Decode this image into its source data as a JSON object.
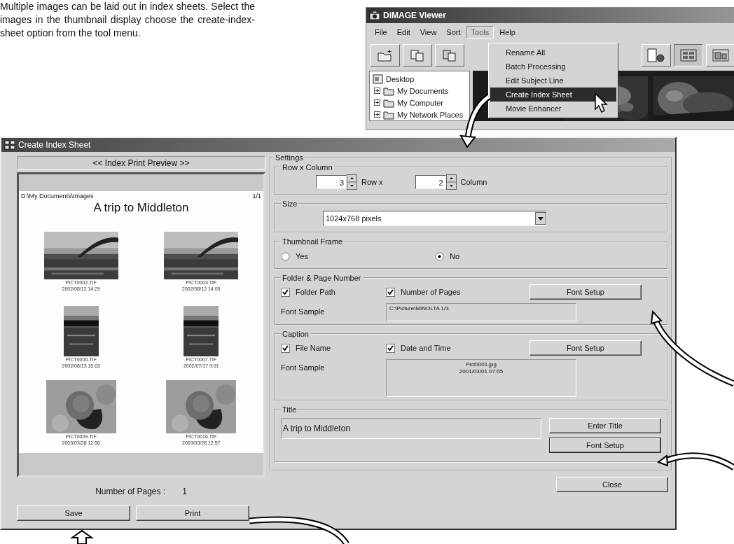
{
  "intro_text": "Multiple images can be laid out in index sheets. Select the images in the thumbnail display choose the create-index-sheet option from the tool menu.",
  "viewer": {
    "title": "DiMAGE Viewer",
    "menu": [
      {
        "label": "File",
        "selected": false
      },
      {
        "label": "Edit",
        "selected": false
      },
      {
        "label": "View",
        "selected": false
      },
      {
        "label": "Sort",
        "selected": false
      },
      {
        "label": "Tools",
        "selected": true
      },
      {
        "label": "Help",
        "selected": false
      }
    ],
    "tools_menu": [
      {
        "label": "Rename All",
        "selected": false
      },
      {
        "label": "Batch Processing",
        "selected": false
      },
      {
        "label": "Edit Subject Line",
        "selected": false
      },
      {
        "label": "Create Index Sheet",
        "selected": true
      },
      {
        "label": "Movie Enhancer",
        "selected": false
      }
    ],
    "folder_tree": [
      {
        "label": "Desktop",
        "children": [
          {
            "label": "My Documents"
          },
          {
            "label": "My Computer"
          },
          {
            "label": "My Network Places"
          }
        ]
      }
    ]
  },
  "dialog": {
    "title": "Create Index Sheet",
    "preview": {
      "header": "<< Index Print Preview >>",
      "folder_path": "D:\\My Documents\\Images",
      "page_number": "1/1",
      "title": "A trip to Middleton",
      "thumbnails": [
        {
          "file_name": "PICT0002.TIF",
          "date_time": "2002/08/12 14:29"
        },
        {
          "file_name": "PICT0003.TIF",
          "date_time": "2002/08/12 14:05"
        },
        {
          "file_name": "PICT0006.TIF",
          "date_time": "2002/08/13 15:03"
        },
        {
          "file_name": "PICT0007.TIF",
          "date_time": "2002/07/17 9:01"
        },
        {
          "file_name": "PICT0009.TIF",
          "date_time": "2003/03/28 12:56"
        },
        {
          "file_name": "PICT0016.TIF",
          "date_time": "2003/03/28 12:57"
        }
      ]
    },
    "pages_label": "Number of Pages :",
    "pages_value": "1",
    "save_button": "Save",
    "print_button": "Print",
    "close_button": "Close",
    "settings": {
      "label": "Settings",
      "row_column": {
        "label": "Row x Column",
        "rows": "3",
        "row_label": "Row  x",
        "columns": "2",
        "column_label": "Column"
      },
      "size": {
        "label": "Size",
        "value": "1024x768 pixels"
      },
      "thumbnail_frame": {
        "label": "Thumbnail Frame",
        "options": [
          {
            "label": "Yes",
            "selected": false
          },
          {
            "label": "No",
            "selected": true
          }
        ]
      },
      "folder_page": {
        "label": "Folder & Page Number",
        "checks": [
          {
            "label": "Folder Path",
            "checked": true
          },
          {
            "label": "Number of Pages",
            "checked": true
          }
        ],
        "font_button": "Font Setup",
        "sample_label": "Font Sample",
        "sample": [
          "C:\\Picture\\MINOLTA  1/3"
        ]
      },
      "caption": {
        "label": "Caption",
        "checks": [
          {
            "label": "File Name",
            "checked": true
          },
          {
            "label": "Date and Time",
            "checked": true
          }
        ],
        "font_button": "Font Setup",
        "sample_label": "Font Sample",
        "sample": [
          "Pict0001.jpg",
          "2001/03/01 07:05"
        ]
      },
      "title": {
        "label": "Title",
        "value": "A trip to Middleton",
        "enter_button": "Enter Title",
        "font_button": "Font Setup"
      }
    }
  }
}
